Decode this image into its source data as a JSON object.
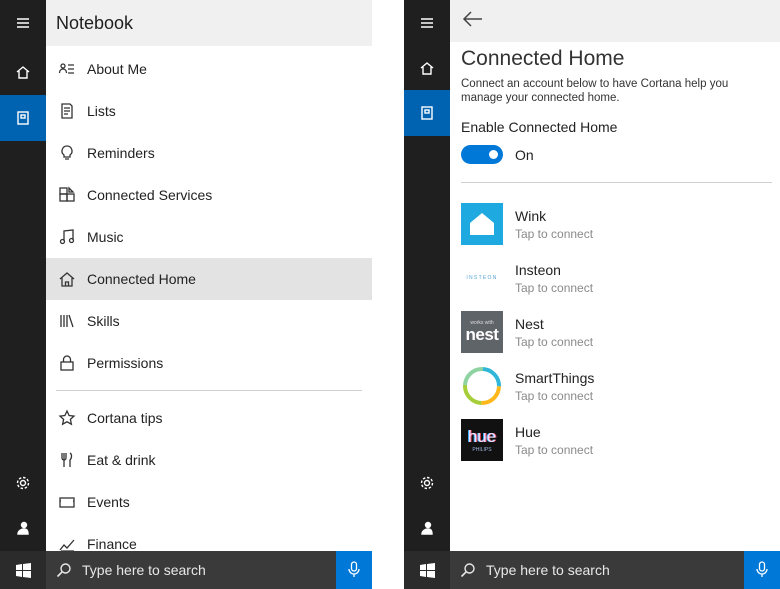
{
  "notebook": {
    "title": "Notebook",
    "items": [
      {
        "label": "About Me",
        "icon": "about-me-icon"
      },
      {
        "label": "Lists",
        "icon": "lists-icon"
      },
      {
        "label": "Reminders",
        "icon": "reminders-icon"
      },
      {
        "label": "Connected Services",
        "icon": "connected-services-icon"
      },
      {
        "label": "Music",
        "icon": "music-icon"
      },
      {
        "label": "Connected Home",
        "icon": "home-icon",
        "selected": true
      },
      {
        "label": "Skills",
        "icon": "skills-icon"
      },
      {
        "label": "Permissions",
        "icon": "lock-icon"
      }
    ],
    "items2": [
      {
        "label": "Cortana tips",
        "icon": "star-icon"
      },
      {
        "label": "Eat & drink",
        "icon": "fork-knife-icon"
      },
      {
        "label": "Events",
        "icon": "events-icon"
      },
      {
        "label": "Finance",
        "icon": "finance-icon"
      }
    ]
  },
  "connected_home": {
    "title": "Connected Home",
    "description": "Connect an account below to have Cortana help you manage your connected home.",
    "enable_label": "Enable Connected Home",
    "toggle_state": "On",
    "devices": [
      {
        "name": "Wink",
        "sub": "Tap to connect"
      },
      {
        "name": "Insteon",
        "sub": "Tap to connect",
        "logo_text": "INSTEON"
      },
      {
        "name": "Nest",
        "sub": "Tap to connect",
        "logo_text": "nest",
        "logo_small": "works with"
      },
      {
        "name": "SmartThings",
        "sub": "Tap to connect"
      },
      {
        "name": "Hue",
        "sub": "Tap to connect",
        "logo_text": "hue",
        "logo_small": "PHILIPS"
      }
    ]
  },
  "taskbar": {
    "search_placeholder": "Type here to search"
  },
  "colors": {
    "accent": "#0078d7",
    "rail_active": "#0063b1",
    "rail": "#1f1f1f",
    "taskbar": "#2b2b2b"
  }
}
